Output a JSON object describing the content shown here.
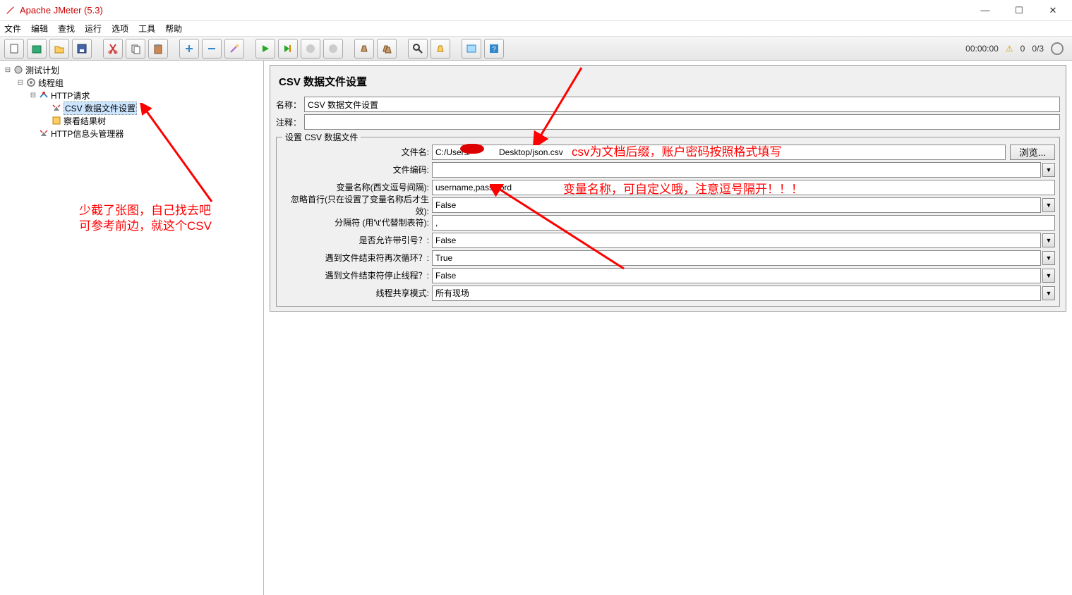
{
  "window": {
    "title": "Apache JMeter (5.3)"
  },
  "menu": [
    "文件",
    "编辑",
    "查找",
    "运行",
    "选项",
    "工具",
    "帮助"
  ],
  "status": {
    "time": "00:00:00",
    "errors": "0",
    "threads": "0/3"
  },
  "tree": {
    "root": "测试计划",
    "thread_group": "线程组",
    "http_request": "HTTP请求",
    "csv_config": "CSV 数据文件设置",
    "result_tree": "察看结果树",
    "header_manager": "HTTP信息头管理器"
  },
  "panel": {
    "title": "CSV 数据文件设置",
    "name_label": "名称：",
    "name_value": "CSV 数据文件设置",
    "comment_label": "注释：",
    "comment_value": "",
    "fieldset_title": "设置 CSV 数据文件",
    "rows": {
      "filename_label": "文件名:",
      "filename_value": "C:/Users/            Desktop/json.csv",
      "browse": "浏览...",
      "encoding_label": "文件编码:",
      "encoding_value": "",
      "varnames_label": "变量名称(西文逗号间隔):",
      "varnames_value": "username,password",
      "ignore_first_label": "忽略首行(只在设置了变量名称后才生效):",
      "ignore_first_value": "False",
      "delimiter_label": "分隔符 (用'\\t'代替制表符):",
      "delimiter_value": ",",
      "allow_quote_label": "是否允许带引号？:",
      "allow_quote_value": "False",
      "recycle_label": "遇到文件结束符再次循环？:",
      "recycle_value": "True",
      "stop_label": "遇到文件结束符停止线程？:",
      "stop_value": "False",
      "share_label": "线程共享模式:",
      "share_value": "所有现场"
    }
  },
  "annotations": {
    "a1": "csv为文档后缀，账户密码按照格式填写",
    "a2": "变量名称，可自定义哦，注意逗号隔开！！！",
    "a3_line1": "少截了张图，自己找去吧",
    "a3_line2": "可参考前边，就这个CSV"
  }
}
